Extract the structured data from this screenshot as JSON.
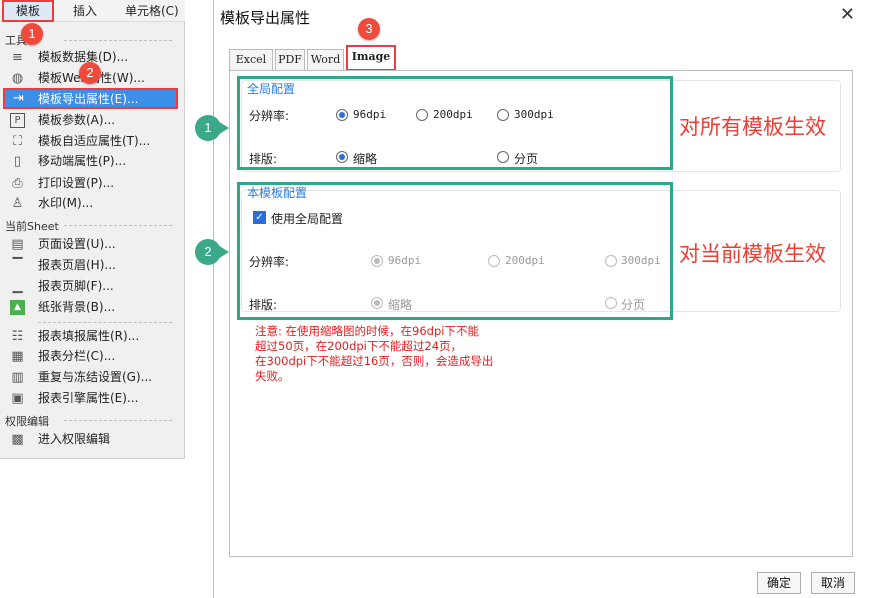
{
  "menubar": {
    "items": [
      "模板",
      "插入",
      "单元格(C)"
    ]
  },
  "menu": {
    "section_tools": "工具",
    "section_sheet": "当前Sheet",
    "section_perm": "权限编辑",
    "items": [
      {
        "label": "模板数据集(D)...",
        "icon": "database-icon"
      },
      {
        "label": "模板Web属性(W)...",
        "icon": "globe-icon"
      },
      {
        "label": "模板导出属性(E)...",
        "icon": "export-icon"
      },
      {
        "label": "模板参数(A)...",
        "icon": "parameter-icon"
      },
      {
        "label": "模板自适应属性(T)...",
        "icon": "adaptive-icon"
      },
      {
        "label": "移动端属性(P)...",
        "icon": "mobile-icon"
      },
      {
        "label": "打印设置(P)...",
        "icon": "printer-icon"
      },
      {
        "label": "水印(M)...",
        "icon": "watermark-icon"
      },
      {
        "label": "页面设置(U)...",
        "icon": "page-setup-icon"
      },
      {
        "label": "报表页眉(H)...",
        "icon": "header-icon"
      },
      {
        "label": "报表页脚(F)...",
        "icon": "footer-icon"
      },
      {
        "label": "纸张背景(B)...",
        "icon": "background-image-icon"
      },
      {
        "label": "报表填报属性(R)...",
        "icon": "form-icon"
      },
      {
        "label": "报表分栏(C)...",
        "icon": "columns-icon"
      },
      {
        "label": "重复与冻结设置(G)...",
        "icon": "freeze-icon"
      },
      {
        "label": "报表引擎属性(E)...",
        "icon": "engine-icon"
      },
      {
        "label": "进入权限编辑",
        "icon": "permission-icon"
      }
    ]
  },
  "badges": [
    "1",
    "2",
    "3"
  ],
  "dialog": {
    "title": "模板导出属性",
    "close": "✕",
    "tabs": [
      "Excel",
      "PDF",
      "Word",
      "Image"
    ],
    "global": {
      "title": "全局配置",
      "resolution_label": "分辨率:",
      "resolutions": [
        "96dpi",
        "200dpi",
        "300dpi"
      ],
      "layout_label": "排版:",
      "layouts": [
        "缩略",
        "分页"
      ]
    },
    "local": {
      "title": "本模板配置",
      "use_global": "使用全局配置",
      "resolution_label": "分辨率:",
      "resolutions": [
        "96dpi",
        "200dpi",
        "300dpi"
      ],
      "layout_label": "排版:",
      "layouts": [
        "缩略",
        "分页"
      ]
    },
    "note_lines": [
      "注意: 在使用缩略图的时候，在96dpi下不能",
      "超过50页，在200dpi下不能超过24页，",
      "在300dpi下不能超过16页，否则，会造成导出",
      "失败。"
    ],
    "ok": "确定",
    "cancel": "取消"
  },
  "annotations": {
    "callout1": "1",
    "callout2": "2",
    "text1": "对所有模板生效",
    "text2": "对当前模板生效"
  },
  "colors": {
    "accent_red": "#ee3b3b",
    "callout_green": "#3aa889",
    "selection_blue": "#3d8ee8",
    "group_title_blue": "#2a7de0"
  }
}
